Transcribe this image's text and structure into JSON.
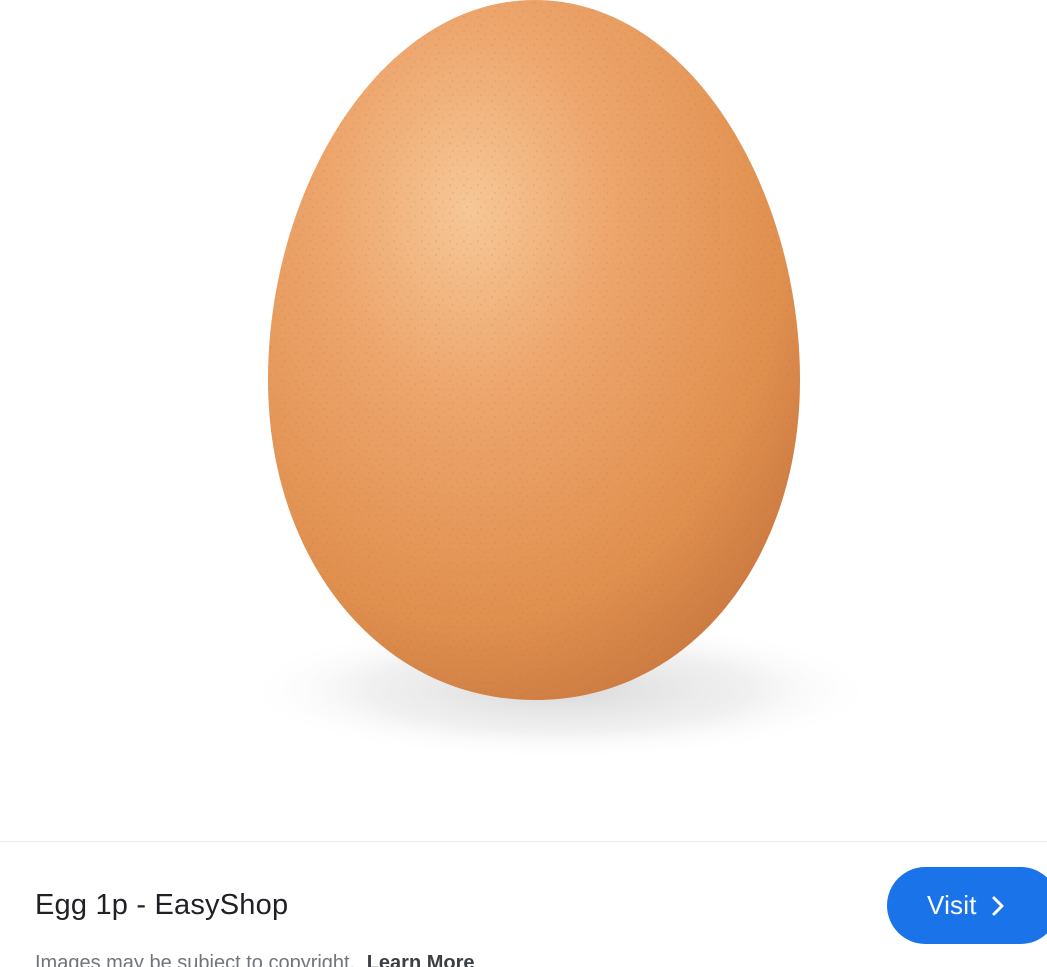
{
  "image": {
    "subject": "egg-photo"
  },
  "result": {
    "title": "Egg 1p - EasyShop",
    "visit_label": "Visit",
    "copyright_text": "Images may be subject to copyright.",
    "learn_more_label": "Learn More"
  },
  "colors": {
    "accent": "#1a73e8",
    "egg_main": "#e69a5e",
    "egg_highlight": "#f3c08f",
    "egg_shadow": "#c87a45"
  },
  "icons": {
    "visit_icon": "chevron-right-icon"
  }
}
